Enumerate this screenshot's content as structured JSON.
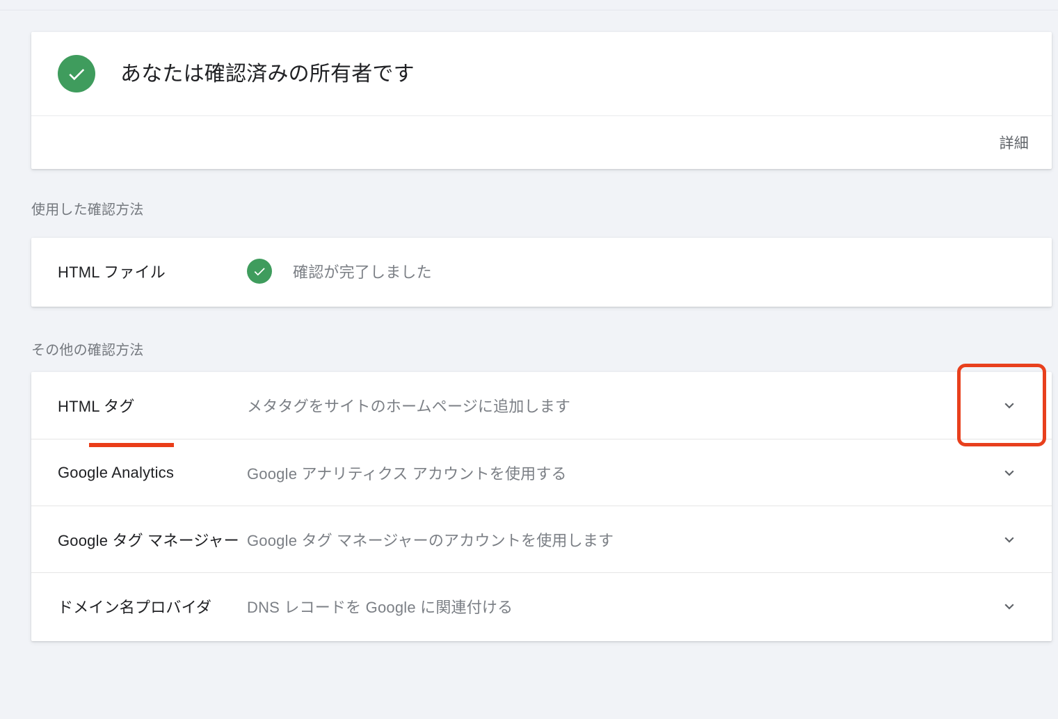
{
  "owner_status": {
    "title": "あなたは確認済みの所有者です",
    "details_label": "詳細",
    "icon": "check-circle-icon"
  },
  "used_section": {
    "heading": "使用した確認方法",
    "method": {
      "name": "HTML ファイル",
      "status_text": "確認が完了しました",
      "status_icon": "check-circle-icon"
    }
  },
  "other_section": {
    "heading": "その他の確認方法",
    "methods": [
      {
        "name": "HTML タグ",
        "description": "メタタグをサイトのホームページに追加します",
        "expand_icon": "chevron-down-icon"
      },
      {
        "name": "Google Analytics",
        "description": "Google アナリティクス アカウントを使用する",
        "expand_icon": "chevron-down-icon"
      },
      {
        "name": "Google タグ マネージャー",
        "description": "Google タグ マネージャーのアカウントを使用します",
        "expand_icon": "chevron-down-icon"
      },
      {
        "name": "ドメイン名プロバイダ",
        "description": "DNS レコードを Google に関連付ける",
        "expand_icon": "chevron-down-icon"
      }
    ]
  },
  "annotations": {
    "underline_color": "#ea3d19",
    "box_color": "#e8401d",
    "underlined_target": "HTML タグ",
    "boxed_target": "chevron-down-icon"
  },
  "colors": {
    "page_background": "#f1f3f7",
    "card_background": "#ffffff",
    "success_green": "#3f9c5d",
    "primary_text": "#202124",
    "secondary_text": "#7b7f85",
    "divider": "#e6e6e6"
  }
}
